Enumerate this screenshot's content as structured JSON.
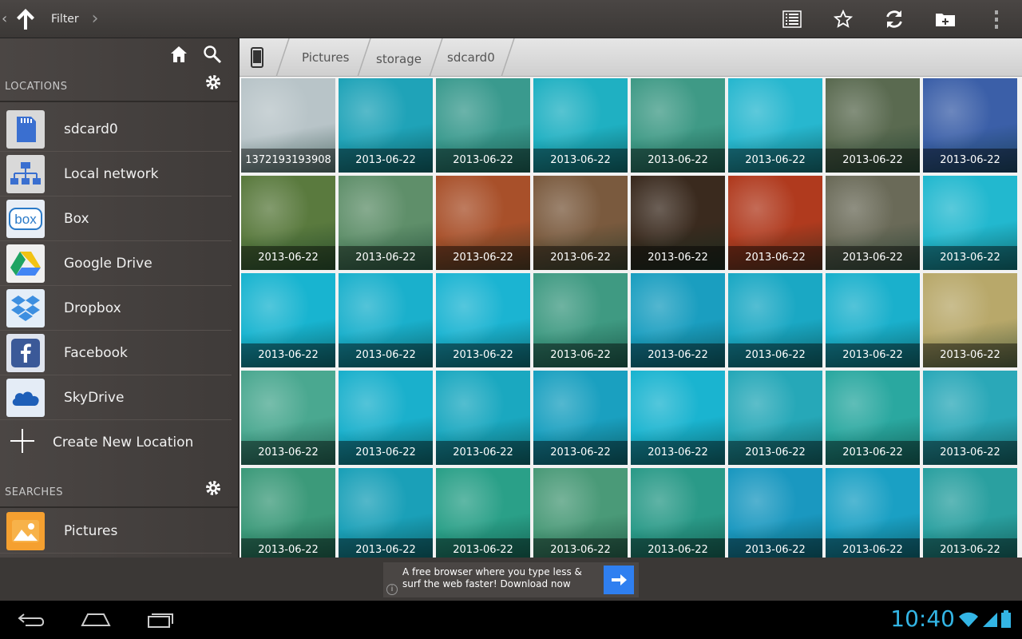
{
  "actionbar": {
    "title": "Filter",
    "icons": [
      "up-arrow-icon",
      "list-view-icon",
      "star-icon",
      "refresh-icon",
      "new-folder-icon",
      "overflow-menu-icon"
    ]
  },
  "sidebar": {
    "locations_label": "LOCATIONS",
    "searches_label": "SEARCHES",
    "locations": [
      {
        "label": "sdcard0",
        "icon": "sdcard-icon"
      },
      {
        "label": "Local network",
        "icon": "network-icon"
      },
      {
        "label": "Box",
        "icon": "box-icon"
      },
      {
        "label": "Google Drive",
        "icon": "google-drive-icon"
      },
      {
        "label": "Dropbox",
        "icon": "dropbox-icon"
      },
      {
        "label": "Facebook",
        "icon": "facebook-icon"
      },
      {
        "label": "SkyDrive",
        "icon": "skydrive-icon"
      }
    ],
    "create_label": "Create New Location",
    "searches": [
      {
        "label": "Pictures",
        "icon": "pictures-icon"
      }
    ]
  },
  "breadcrumb": {
    "items": [
      "Pictures",
      "storage",
      "sdcard0"
    ]
  },
  "grid": {
    "columns": 8,
    "rows": [
      [
        "1372193193908",
        "2013-06-22",
        "2013-06-22",
        "2013-06-22",
        "2013-06-22",
        "2013-06-22",
        "2013-06-22",
        "2013-06-22"
      ],
      [
        "2013-06-22",
        "2013-06-22",
        "2013-06-22",
        "2013-06-22",
        "2013-06-22",
        "2013-06-22",
        "2013-06-22",
        "2013-06-22"
      ],
      [
        "2013-06-22",
        "2013-06-22",
        "2013-06-22",
        "2013-06-22",
        "2013-06-22",
        "2013-06-22",
        "2013-06-22",
        "2013-06-22"
      ],
      [
        "2013-06-22",
        "2013-06-22",
        "2013-06-22",
        "2013-06-22",
        "2013-06-22",
        "2013-06-22",
        "2013-06-22",
        "2013-06-22"
      ],
      [
        "2013-06-22",
        "2013-06-22",
        "2013-06-22",
        "2013-06-22",
        "2013-06-22",
        "2013-06-22",
        "2013-06-22",
        "2013-06-22"
      ]
    ],
    "tile_colors": [
      [
        "#b8c4c8",
        "#1fa3b8",
        "#3a9a8e",
        "#1fb0c2",
        "#3f9a86",
        "#27b7cf",
        "#5a6a50",
        "#3b5fa8"
      ],
      [
        "#5a7a3e",
        "#5f8f6a",
        "#a8502a",
        "#7a5a3e",
        "#3a2a1e",
        "#b03a1e",
        "#6a6a58",
        "#22b8cf"
      ],
      [
        "#18b4d0",
        "#1ab0cc",
        "#1bb4d2",
        "#3f9a82",
        "#1a9ec0",
        "#1aa8c4",
        "#1ab0cc",
        "#b8a86a"
      ],
      [
        "#4aa890",
        "#1ab0cc",
        "#1aa8c0",
        "#1aa0c0",
        "#1ab4d0",
        "#26a8b8",
        "#2aa8a0",
        "#2aa8b8"
      ],
      [
        "#3c9a7a",
        "#1aa0b8",
        "#2aa088",
        "#4a9a78",
        "#2a9a88",
        "#1a98c0",
        "#1aa0c4",
        "#2aa0a0"
      ]
    ]
  },
  "ad": {
    "text": "A free browser where you type less & surf the web faster! Download now",
    "info": "i"
  },
  "statusbar": {
    "time": "10:40"
  }
}
